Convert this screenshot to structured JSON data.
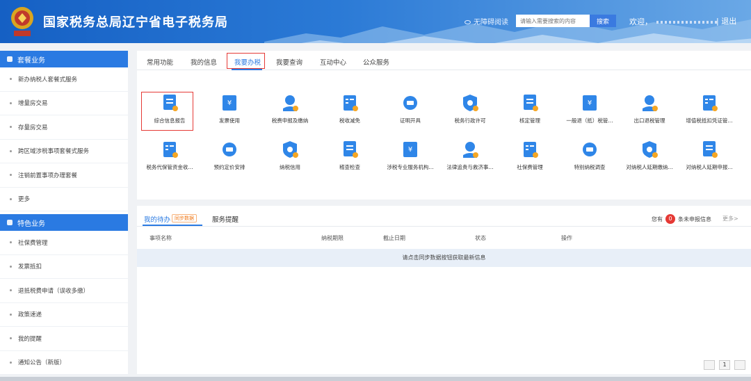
{
  "header": {
    "site_title": "国家税务总局辽宁省电子税务局",
    "accessibility": "无障碍阅读",
    "search_placeholder": "请输入需要搜索的内容",
    "search_button": "搜索",
    "welcome": "欢迎，",
    "logout": "| 退出"
  },
  "sidebar": {
    "section1": {
      "title": "套餐业务",
      "items": [
        "新办纳税人套餐式服务",
        "增量房交易",
        "存量房交易",
        "跨区域涉税事项套餐式服务",
        "注销前置事项办理套餐",
        "更多"
      ]
    },
    "section2": {
      "title": "特色业务",
      "items": [
        "社保费管理",
        "发票抵扣",
        "退抵税费申请（误收多缴）",
        "政策速递",
        "我的提醒",
        "通知公告（新版）"
      ]
    }
  },
  "main": {
    "tabs": [
      "常用功能",
      "我的信息",
      "我要办税",
      "我要查询",
      "互动中心",
      "公众服务"
    ],
    "active_tab": "我要办税",
    "functions_row1": [
      "综合信息报告",
      "发票使用",
      "税费申报及缴纳",
      "税收减免",
      "证明开具",
      "税务行政许可",
      "核定管理",
      "一般退（抵）税管...",
      "出口退税管理",
      "增值税抵扣凭证管..."
    ],
    "functions_row2": [
      "税务代保管资金收...",
      "预约定价安排",
      "纳税信用",
      "稽查检查",
      "涉税专业服务机构...",
      "法律追责与救济事...",
      "社保费管理",
      "特别纳税调查",
      "对纳税人延期缴纳...",
      "对纳税人延期申报..."
    ]
  },
  "todo": {
    "tab_mine": "我的待办",
    "sync_badge": "同步数据",
    "tab_reminder": "服务提醒",
    "unreported_prefix": "您有",
    "unreported_count": "0",
    "unreported_suffix": "条未申报信息",
    "more": "更多>",
    "columns": [
      "事项名称",
      "纳税期限",
      "截止日期",
      "状态",
      "操作"
    ],
    "empty_message": "请点击同步数据按钮获取最新信息",
    "page": "1"
  },
  "colors": {
    "primary": "#2a7ae2",
    "highlight_border": "#e53935",
    "icon_blue": "#2f86e8",
    "icon_orange": "#f5a623"
  }
}
